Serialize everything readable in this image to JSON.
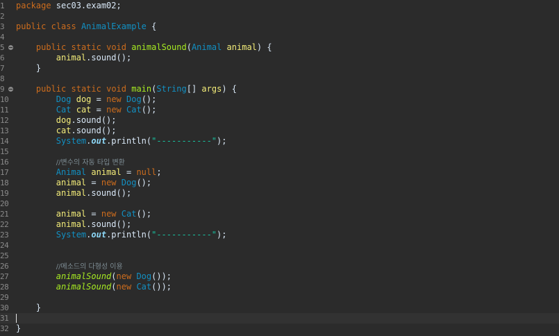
{
  "editor": {
    "lines": [
      {
        "n": "1",
        "tokens": [
          [
            "kw",
            "package"
          ],
          [
            "pl",
            " sec03.exam02;"
          ]
        ]
      },
      {
        "n": "2",
        "tokens": []
      },
      {
        "n": "3",
        "tokens": [
          [
            "kw",
            "public"
          ],
          [
            "pl",
            " "
          ],
          [
            "kw",
            "class"
          ],
          [
            "pl",
            " "
          ],
          [
            "ty",
            "AnimalExample"
          ],
          [
            "pl",
            " {"
          ]
        ]
      },
      {
        "n": "4",
        "tokens": []
      },
      {
        "n": "5",
        "fold": true,
        "tokens": [
          [
            "pl",
            "    "
          ],
          [
            "kw",
            "public"
          ],
          [
            "pl",
            " "
          ],
          [
            "kw",
            "static"
          ],
          [
            "pl",
            " "
          ],
          [
            "kw",
            "void"
          ],
          [
            "pl",
            " "
          ],
          [
            "fn",
            "animalSound"
          ],
          [
            "pl",
            "("
          ],
          [
            "ty",
            "Animal"
          ],
          [
            "pl",
            " "
          ],
          [
            "vr",
            "animal"
          ],
          [
            "pl",
            ") {"
          ]
        ]
      },
      {
        "n": "6",
        "tokens": [
          [
            "pl",
            "        "
          ],
          [
            "vr",
            "animal"
          ],
          [
            "pl",
            ".sound();"
          ]
        ]
      },
      {
        "n": "7",
        "tokens": [
          [
            "pl",
            "    }"
          ]
        ]
      },
      {
        "n": "8",
        "tokens": []
      },
      {
        "n": "9",
        "fold": true,
        "tokens": [
          [
            "pl",
            "    "
          ],
          [
            "kw",
            "public"
          ],
          [
            "pl",
            " "
          ],
          [
            "kw",
            "static"
          ],
          [
            "pl",
            " "
          ],
          [
            "kw",
            "void"
          ],
          [
            "pl",
            " "
          ],
          [
            "fn",
            "main"
          ],
          [
            "pl",
            "("
          ],
          [
            "ty",
            "String"
          ],
          [
            "pl",
            "[] "
          ],
          [
            "vr",
            "args"
          ],
          [
            "pl",
            ") {"
          ]
        ]
      },
      {
        "n": "10",
        "tokens": [
          [
            "pl",
            "        "
          ],
          [
            "ty",
            "Dog"
          ],
          [
            "pl",
            " "
          ],
          [
            "vr",
            "dog"
          ],
          [
            "pl",
            " = "
          ],
          [
            "kw",
            "new"
          ],
          [
            "pl",
            " "
          ],
          [
            "ty",
            "Dog"
          ],
          [
            "pl",
            "();"
          ]
        ]
      },
      {
        "n": "11",
        "tokens": [
          [
            "pl",
            "        "
          ],
          [
            "ty",
            "Cat"
          ],
          [
            "pl",
            " "
          ],
          [
            "vr",
            "cat"
          ],
          [
            "pl",
            " = "
          ],
          [
            "kw",
            "new"
          ],
          [
            "pl",
            " "
          ],
          [
            "ty",
            "Cat"
          ],
          [
            "pl",
            "();"
          ]
        ]
      },
      {
        "n": "12",
        "tokens": [
          [
            "pl",
            "        "
          ],
          [
            "vr",
            "dog"
          ],
          [
            "pl",
            ".sound();"
          ]
        ]
      },
      {
        "n": "13",
        "tokens": [
          [
            "pl",
            "        "
          ],
          [
            "vr",
            "cat"
          ],
          [
            "pl",
            ".sound();"
          ]
        ]
      },
      {
        "n": "14",
        "tokens": [
          [
            "pl",
            "        "
          ],
          [
            "ty",
            "System"
          ],
          [
            "pl",
            "."
          ],
          [
            "sf",
            "out"
          ],
          [
            "pl",
            ".println("
          ],
          [
            "st",
            "\"-----------\""
          ],
          [
            "pl",
            ");"
          ]
        ]
      },
      {
        "n": "15",
        "tokens": []
      },
      {
        "n": "16",
        "tokens": [
          [
            "pl",
            "        "
          ],
          [
            "cm",
            "//변수의 자동 타입 변환"
          ]
        ]
      },
      {
        "n": "17",
        "tokens": [
          [
            "pl",
            "        "
          ],
          [
            "ty",
            "Animal"
          ],
          [
            "pl",
            " "
          ],
          [
            "vr",
            "animal"
          ],
          [
            "pl",
            " = "
          ],
          [
            "kw",
            "null"
          ],
          [
            "pl",
            ";"
          ]
        ]
      },
      {
        "n": "18",
        "tokens": [
          [
            "pl",
            "        "
          ],
          [
            "vr",
            "animal"
          ],
          [
            "pl",
            " = "
          ],
          [
            "kw",
            "new"
          ],
          [
            "pl",
            " "
          ],
          [
            "ty",
            "Dog"
          ],
          [
            "pl",
            "();"
          ]
        ]
      },
      {
        "n": "19",
        "tokens": [
          [
            "pl",
            "        "
          ],
          [
            "vr",
            "animal"
          ],
          [
            "pl",
            ".sound();"
          ]
        ]
      },
      {
        "n": "20",
        "tokens": []
      },
      {
        "n": "21",
        "tokens": [
          [
            "pl",
            "        "
          ],
          [
            "vr",
            "animal"
          ],
          [
            "pl",
            " = "
          ],
          [
            "kw",
            "new"
          ],
          [
            "pl",
            " "
          ],
          [
            "ty",
            "Cat"
          ],
          [
            "pl",
            "();"
          ]
        ]
      },
      {
        "n": "22",
        "tokens": [
          [
            "pl",
            "        "
          ],
          [
            "vr",
            "animal"
          ],
          [
            "pl",
            ".sound();"
          ]
        ]
      },
      {
        "n": "23",
        "tokens": [
          [
            "pl",
            "        "
          ],
          [
            "ty",
            "System"
          ],
          [
            "pl",
            "."
          ],
          [
            "sf",
            "out"
          ],
          [
            "pl",
            ".println("
          ],
          [
            "st",
            "\"-----------\""
          ],
          [
            "pl",
            ");"
          ]
        ]
      },
      {
        "n": "24",
        "tokens": []
      },
      {
        "n": "25",
        "tokens": []
      },
      {
        "n": "26",
        "tokens": [
          [
            "pl",
            "        "
          ],
          [
            "cm",
            "//메소드의 다형성 이용"
          ]
        ]
      },
      {
        "n": "27",
        "tokens": [
          [
            "pl",
            "        "
          ],
          [
            "fn it",
            "animalSound"
          ],
          [
            "pl",
            "("
          ],
          [
            "kw",
            "new"
          ],
          [
            "pl",
            " "
          ],
          [
            "ty",
            "Dog"
          ],
          [
            "pl",
            "());"
          ]
        ]
      },
      {
        "n": "28",
        "tokens": [
          [
            "pl",
            "        "
          ],
          [
            "fn it",
            "animalSound"
          ],
          [
            "pl",
            "("
          ],
          [
            "kw",
            "new"
          ],
          [
            "pl",
            " "
          ],
          [
            "ty",
            "Cat"
          ],
          [
            "pl",
            "());"
          ]
        ]
      },
      {
        "n": "29",
        "tokens": []
      },
      {
        "n": "30",
        "tokens": [
          [
            "pl",
            "    }"
          ]
        ]
      },
      {
        "n": "31",
        "current": true,
        "caret": true,
        "tokens": []
      },
      {
        "n": "32",
        "tokens": [
          [
            "pl",
            "}"
          ]
        ]
      }
    ]
  },
  "colors": {
    "background": "#2b2b2b",
    "current_line": "#323232",
    "keyword": "#cc6c1d",
    "type": "#1290c3",
    "method": "#a7ec21",
    "variable": "#f3ec79",
    "string": "#17c6a3",
    "comment": "#7d8c93",
    "static_field": "#8dd8f8",
    "plain": "#d9e8f7",
    "line_number": "#8a8a8a"
  },
  "icons": {
    "fold": "fold-collapse-icon"
  }
}
